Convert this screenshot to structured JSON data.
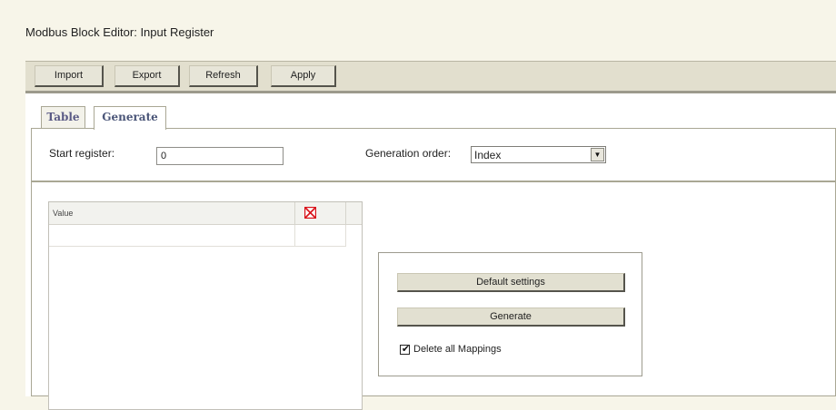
{
  "window": {
    "title": "Modbus Block Editor: Input Register"
  },
  "toolbar": {
    "buttons": [
      {
        "label": "Import"
      },
      {
        "label": "Export"
      },
      {
        "label": "Refresh"
      },
      {
        "label": "Apply"
      }
    ]
  },
  "tabs": [
    {
      "label": "Table",
      "active": false
    },
    {
      "label": "Generate",
      "active": true
    }
  ],
  "generate": {
    "start_register": {
      "label": "Start register:",
      "value": "0"
    },
    "generation_order": {
      "label": "Generation order:",
      "selected": "Index",
      "arrow_icon": "chevron-down-icon"
    },
    "grid": {
      "columns": [
        {
          "label": "Value"
        },
        {
          "icon": "delete-x-icon",
          "color": "#d8121a"
        }
      ],
      "rows": [
        {
          "value": ""
        }
      ]
    },
    "options": {
      "default_settings_label": "Default settings",
      "generate_label": "Generate",
      "delete_all_mappings": {
        "label": "Delete all Mappings",
        "checked": true
      }
    }
  },
  "colors": {
    "background": "#f7f5e9",
    "toolbar": "#e2dfce",
    "tab_text": "#5a5a85",
    "delete_icon": "#d8121a"
  }
}
